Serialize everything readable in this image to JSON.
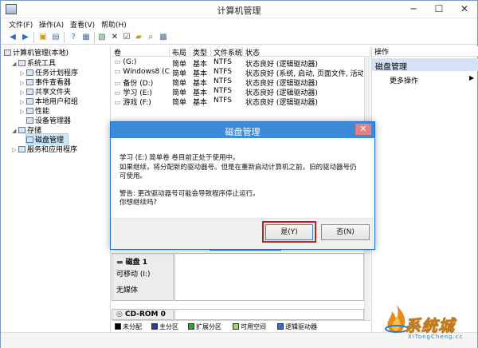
{
  "window": {
    "title": "计算机管理"
  },
  "menu": [
    "文件(F)",
    "操作(A)",
    "查看(V)",
    "帮助(H)"
  ],
  "tree": {
    "root": "计算机管理(本地)",
    "items": [
      {
        "label": "系统工具",
        "level": 1
      },
      {
        "label": "任务计划程序",
        "level": 2
      },
      {
        "label": "事件查看器",
        "level": 2
      },
      {
        "label": "共享文件夹",
        "level": 2
      },
      {
        "label": "本地用户和组",
        "level": 2
      },
      {
        "label": "性能",
        "level": 2
      },
      {
        "label": "设备管理器",
        "level": 2
      },
      {
        "label": "存储",
        "level": 1
      },
      {
        "label": "磁盘管理",
        "level": 2,
        "selected": true
      },
      {
        "label": "服务和应用程序",
        "level": 1
      }
    ]
  },
  "volumes": {
    "headers": [
      "卷",
      "布局",
      "类型",
      "文件系统",
      "状态"
    ],
    "rows": [
      [
        "(G:)",
        "简单",
        "基本",
        "NTFS",
        "状态良好 (逻辑驱动器)"
      ],
      [
        "Windows8 (C:)",
        "简单",
        "基本",
        "NTFS",
        "状态良好 (系统, 启动, 页面文件, 活动, 故障"
      ],
      [
        "备份 (D:)",
        "简单",
        "基本",
        "NTFS",
        "状态良好 (逻辑驱动器)"
      ],
      [
        "学习 (E:)",
        "简单",
        "基本",
        "NTFS",
        "状态良好 (逻辑驱动器)"
      ],
      [
        "游戏 (F:)",
        "简单",
        "基本",
        "NTFS",
        "状态良好 (逻辑驱动器)"
      ]
    ]
  },
  "disks": {
    "disk1": {
      "name": "磁盘 1",
      "type": "可移动 (I:)",
      "media": "无媒体"
    },
    "cdrom": {
      "name": "CD-ROM 0"
    }
  },
  "legend": [
    {
      "label": "未分配",
      "color": "#000000"
    },
    {
      "label": "主分区",
      "color": "#1f3fa8"
    },
    {
      "label": "扩展分区",
      "color": "#2fa43a"
    },
    {
      "label": "可用空间",
      "color": "#9bd86b"
    },
    {
      "label": "逻辑驱动器",
      "color": "#2f6cd6"
    }
  ],
  "actions": {
    "header": "操作",
    "title": "磁盘管理",
    "more": "更多操作"
  },
  "dialog": {
    "title": "磁盘管理",
    "line1": "学习 (E:) 简单卷 卷目前正处于使用中。",
    "line2": "如果继续，将分配新的驱动器号。但是在重新启动计算机之前，旧的驱动器号仍",
    "line3": "可使用。",
    "line4": "警告: 更改驱动器号可能会导致程序停止运行。",
    "line5": "你想继续吗?",
    "yes": "是(Y)",
    "no": "否(N)"
  },
  "watermark": {
    "text": "系统城",
    "url": "XiTongCheng.cc"
  },
  "colors": {
    "accent": "#3d8bd7",
    "highlight": "#d11b1b",
    "action_header": "#d3e3f5"
  }
}
